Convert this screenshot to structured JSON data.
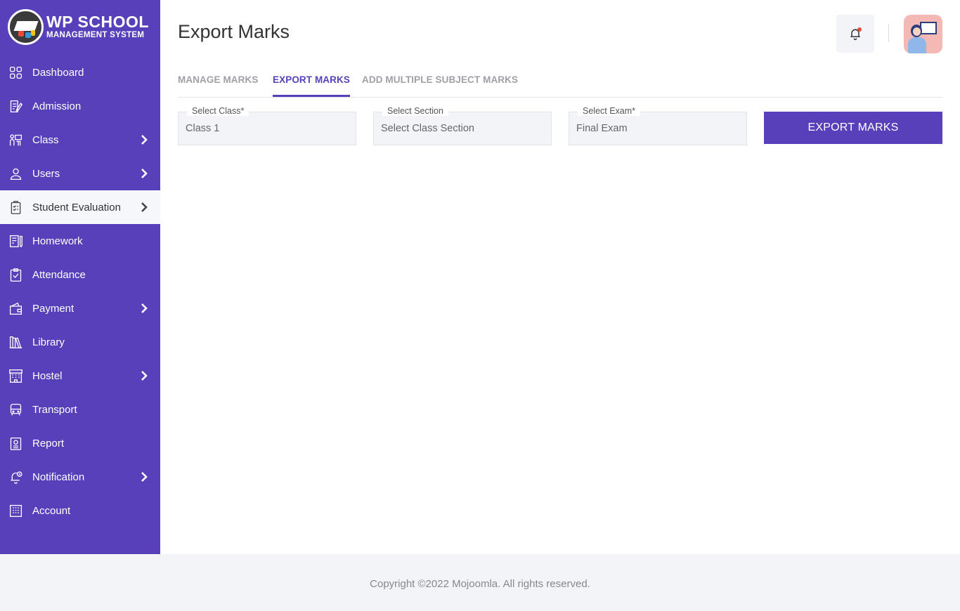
{
  "app": {
    "logo_title": "WP SCHOOL",
    "logo_subtitle": "MANAGEMENT SYSTEM",
    "brand_color": "#5840bb"
  },
  "sidebar": {
    "items": [
      {
        "label": "Dashboard",
        "icon": "dashboard-icon",
        "has_submenu": false,
        "active": false
      },
      {
        "label": "Admission",
        "icon": "admission-icon",
        "has_submenu": false,
        "active": false
      },
      {
        "label": "Class",
        "icon": "class-icon",
        "has_submenu": true,
        "active": false
      },
      {
        "label": "Users",
        "icon": "user-icon",
        "has_submenu": true,
        "active": false
      },
      {
        "label": "Student Evaluation",
        "icon": "clipboard-icon",
        "has_submenu": true,
        "active": true
      },
      {
        "label": "Homework",
        "icon": "homework-icon",
        "has_submenu": false,
        "active": false
      },
      {
        "label": "Attendance",
        "icon": "attendance-icon",
        "has_submenu": false,
        "active": false
      },
      {
        "label": "Payment",
        "icon": "wallet-icon",
        "has_submenu": true,
        "active": false
      },
      {
        "label": "Library",
        "icon": "library-icon",
        "has_submenu": false,
        "active": false
      },
      {
        "label": "Hostel",
        "icon": "hostel-icon",
        "has_submenu": true,
        "active": false
      },
      {
        "label": "Transport",
        "icon": "bus-icon",
        "has_submenu": false,
        "active": false
      },
      {
        "label": "Report",
        "icon": "report-icon",
        "has_submenu": false,
        "active": false
      },
      {
        "label": "Notification",
        "icon": "notification-icon",
        "has_submenu": true,
        "active": false
      },
      {
        "label": "Account",
        "icon": "account-icon",
        "has_submenu": false,
        "active": false
      }
    ]
  },
  "header": {
    "title": "Export Marks"
  },
  "tabs": [
    {
      "label": "MANAGE MARKS",
      "active": false
    },
    {
      "label": "EXPORT MARKS",
      "active": true
    },
    {
      "label": "ADD MULTIPLE SUBJECT MARKS",
      "active": false
    }
  ],
  "form": {
    "class": {
      "label": "Select Class*",
      "value": "Class 1"
    },
    "section": {
      "label": "Select Section",
      "value": "Select Class Section"
    },
    "exam": {
      "label": "Select Exam*",
      "value": "Final Exam"
    },
    "submit_label": "EXPORT MARKS"
  },
  "footer": {
    "copyright": "Copyright ©2022 Mojoomla. All rights reserved."
  }
}
